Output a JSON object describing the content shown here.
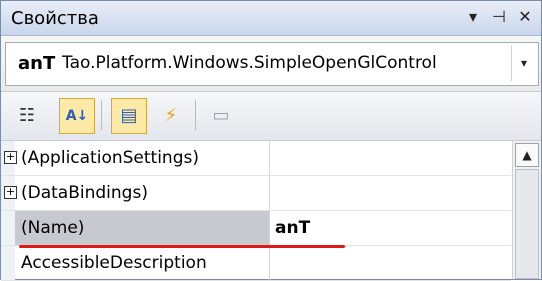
{
  "window": {
    "title": "Свойства",
    "buttons": [
      "▾",
      "⊣",
      "✕"
    ]
  },
  "object_selector": {
    "object_name": "anT",
    "object_type": "Tao.Platform.Windows.SimpleOpenGlControl",
    "dropdown_glyph": "▾"
  },
  "toolbar": {
    "categorized_glyph": "☷",
    "alphabetical_glyph": "A↓",
    "properties_glyph": "▤",
    "events_glyph": "⚡",
    "property_pages_glyph": "▭"
  },
  "properties": [
    {
      "name": "(ApplicationSettings)",
      "value": "",
      "expandable": true,
      "expander": "+"
    },
    {
      "name": "(DataBindings)",
      "value": "",
      "expandable": true,
      "expander": "+"
    },
    {
      "name": "(Name)",
      "value": "anT",
      "selected": true
    },
    {
      "name": "AccessibleDescription",
      "value": ""
    }
  ],
  "scrollbar": {
    "up_glyph": "▲"
  },
  "colors": {
    "selection": "#c6c9cf",
    "highlight_underline": "#e01818",
    "active_tool": "#ffe9a6"
  }
}
